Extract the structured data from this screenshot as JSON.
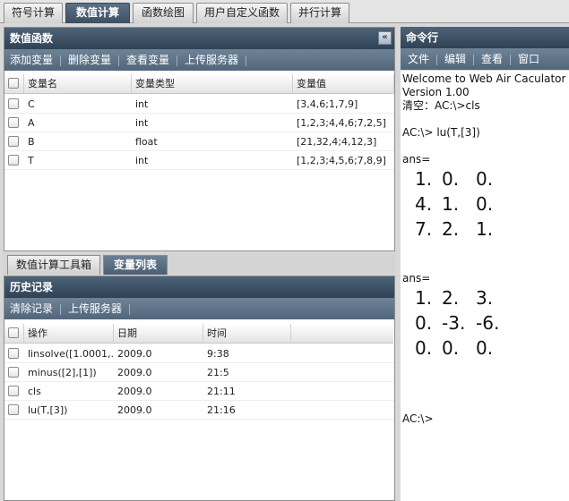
{
  "top_tabs": [
    {
      "label": "符号计算",
      "active": false
    },
    {
      "label": "数值计算",
      "active": true
    },
    {
      "label": "函数绘图",
      "active": false
    },
    {
      "label": "用户自定义函数",
      "active": false
    },
    {
      "label": "并行计算",
      "active": false
    }
  ],
  "numeric_panel": {
    "title": "数值函数",
    "toolbar": [
      "添加变量",
      "删除变量",
      "查看变量",
      "上传服务器"
    ],
    "columns": [
      "变量名",
      "变量类型",
      "变量值"
    ],
    "rows": [
      {
        "name": "C",
        "type": "int",
        "value": "[3,4,6;1,7,9]"
      },
      {
        "name": "A",
        "type": "int",
        "value": "[1,2,3;4,4,6;7,2,5]"
      },
      {
        "name": "B",
        "type": "float",
        "value": "[21,32,4;4,12,3]"
      },
      {
        "name": "T",
        "type": "int",
        "value": "[1,2,3;4,5,6;7,8,9]"
      }
    ]
  },
  "sub_tabs": [
    {
      "label": "数值计算工具箱",
      "active": false
    },
    {
      "label": "变量列表",
      "active": true
    }
  ],
  "history_panel": {
    "title": "历史记录",
    "toolbar": [
      "清除记录",
      "上传服务器"
    ],
    "columns": [
      "操作",
      "日期",
      "时间"
    ],
    "rows": [
      {
        "op": "linsolve([1.0001,...",
        "date": "2009.0",
        "time": "9:38"
      },
      {
        "op": "minus([2],[1])",
        "date": "2009.0",
        "time": "21:5"
      },
      {
        "op": "cls",
        "date": "2009.0",
        "time": "21:11"
      },
      {
        "op": "lu(T,[3])",
        "date": "2009.0",
        "time": "21:16"
      }
    ]
  },
  "command_panel": {
    "title": "命令行",
    "menu": [
      "文件",
      "编辑",
      "查看",
      "窗口"
    ],
    "welcome1": "Welcome to Web Air Caculator",
    "welcome2": "Version 1.00",
    "clear_hint": "清空：AC:\\>cls",
    "cmd": "AC:\\>  lu(T,[3])",
    "ans1_label": "ans=",
    "matrix1": [
      [
        "1.",
        "0.",
        "0."
      ],
      [
        "4.",
        "1.",
        "0."
      ],
      [
        "7.",
        "2.",
        "1."
      ]
    ],
    "ans2_label": "ans=",
    "matrix2": [
      [
        "1.",
        "2.",
        "3."
      ],
      [
        "0.",
        "-3.",
        "-6."
      ],
      [
        "0.",
        "0.",
        "0."
      ]
    ],
    "prompt": "AC:\\>"
  },
  "colors": {
    "title_bar": "#2f4256",
    "toolbar": "#51667b",
    "active_tab": "#3c4f63"
  }
}
